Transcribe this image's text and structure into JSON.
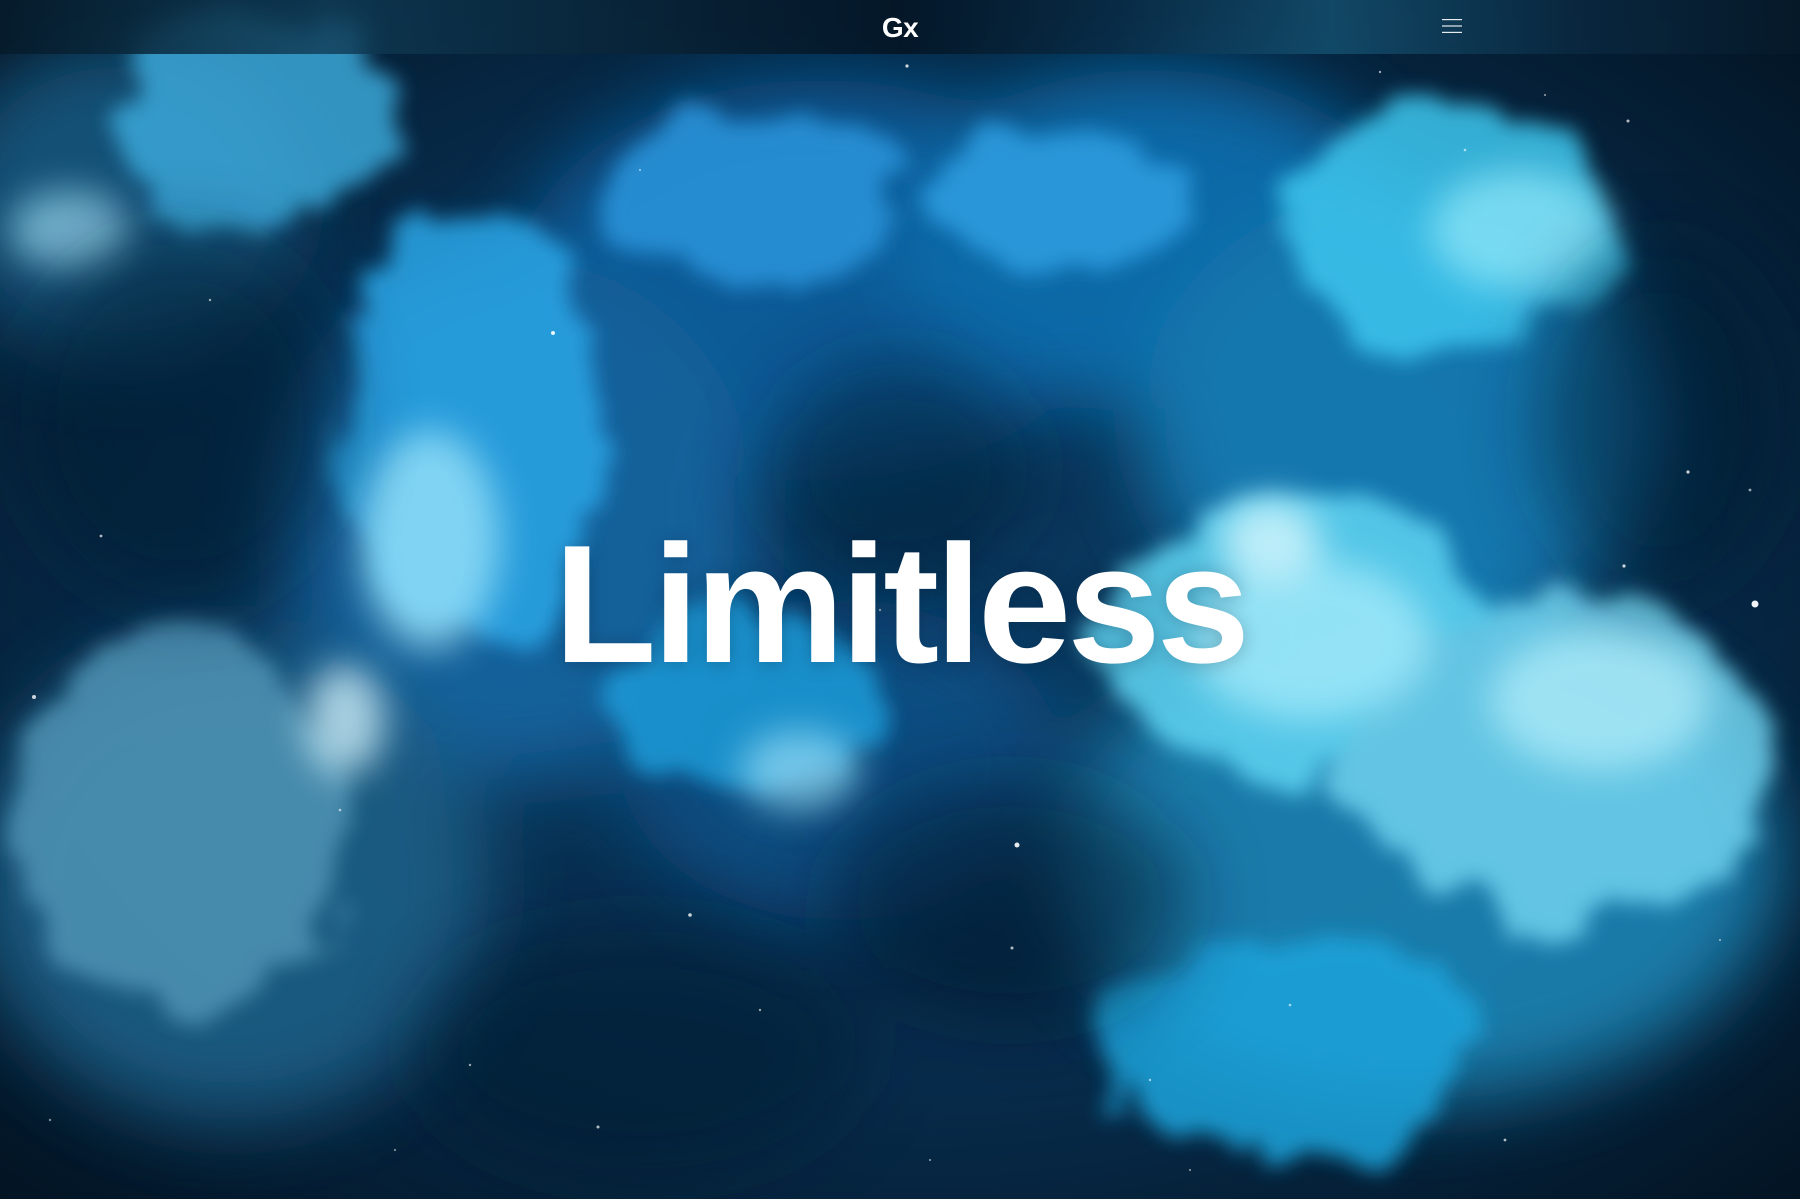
{
  "header": {
    "logo_text": "Gx",
    "menu_icon": "hamburger-menu-icon"
  },
  "hero": {
    "headline": "Limitless",
    "background": "blue-nebula-clouds"
  },
  "colors": {
    "text": "#ffffff",
    "space_dark": "#041526",
    "nebula_blue": "#1e9bd8",
    "nebula_cyan": "#5fd4f2"
  }
}
